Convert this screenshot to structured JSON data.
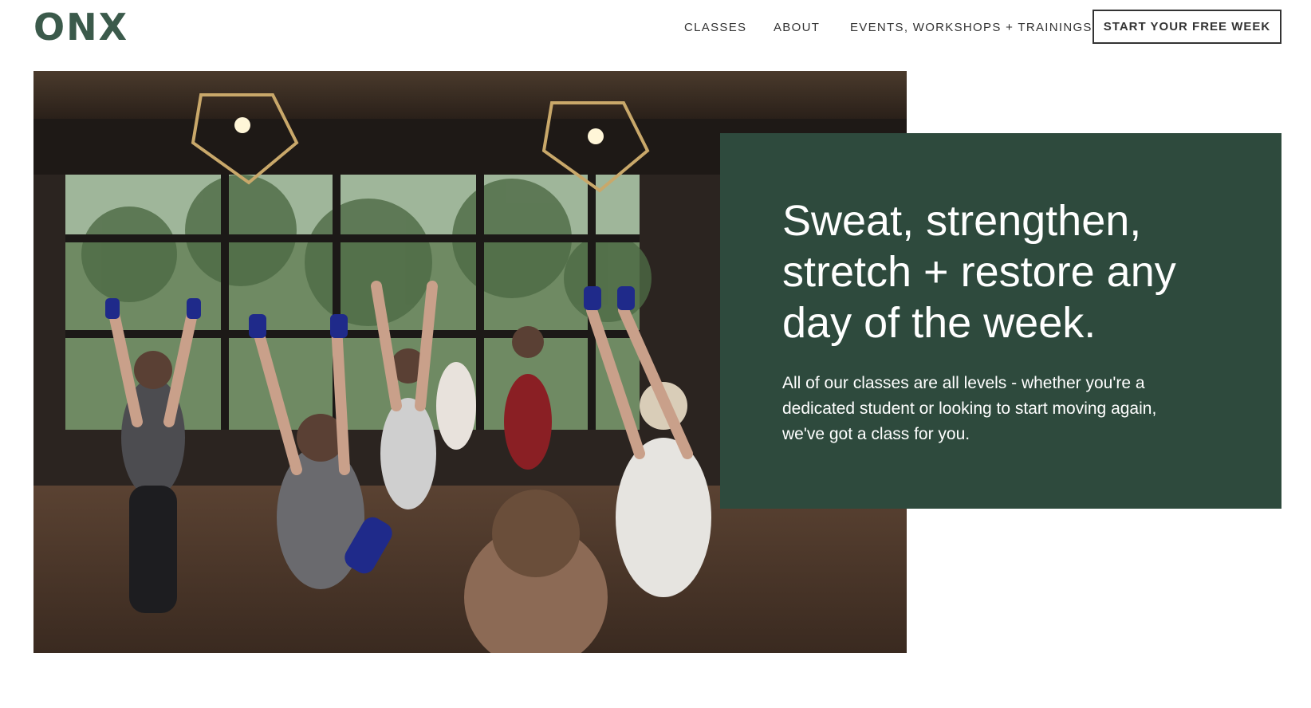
{
  "header": {
    "logo": "ONX",
    "nav": {
      "classes": "CLASSES",
      "about": "ABOUT",
      "events": "EVENTS, WORKSHOPS + TRAININGS"
    },
    "cta_label": "START YOUR FREE WEEK"
  },
  "hero": {
    "headline": "Sweat, strengthen, stretch + restore any day of the week.",
    "subtext": "All of our classes are all levels - whether you're a dedicated student or looking to start moving again, we've got a class for you."
  },
  "colors": {
    "brand_green": "#2e4a3d",
    "logo_green": "#3b5a4b",
    "text_dark": "#333333"
  }
}
